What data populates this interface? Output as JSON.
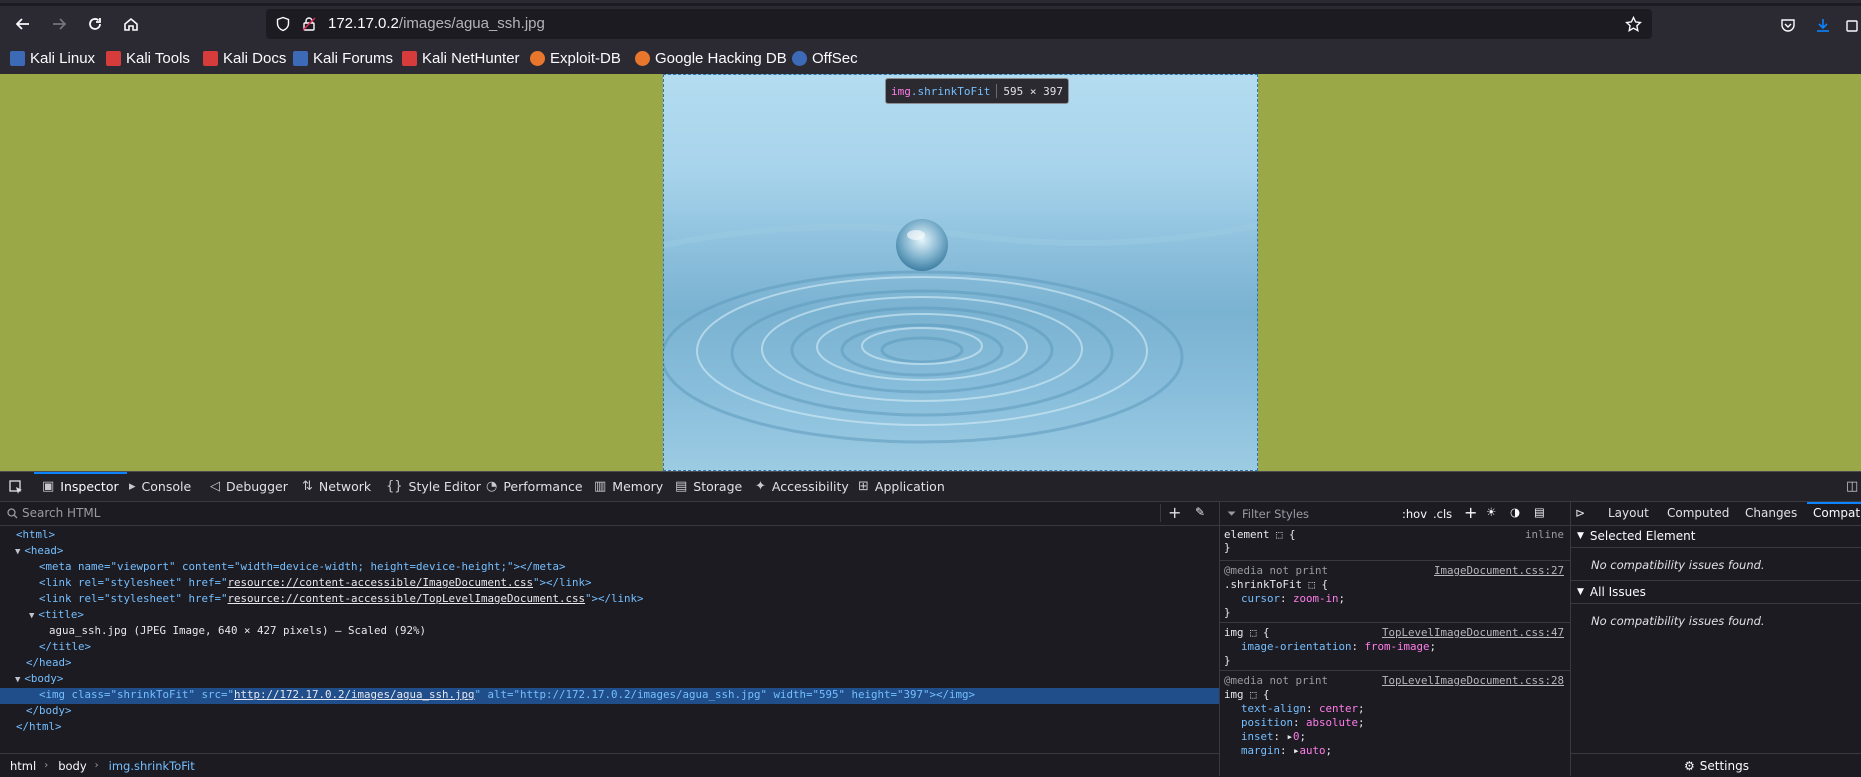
{
  "browser": {
    "url_host": "172.17.0.2",
    "url_path": "/images/agua_ssh.jpg"
  },
  "bookmarks": [
    {
      "label": "Kali Linux",
      "color": "#3d6ab7"
    },
    {
      "label": "Kali Tools",
      "color": "#d63c3c"
    },
    {
      "label": "Kali Docs",
      "color": "#d63c3c"
    },
    {
      "label": "Kali Forums",
      "color": "#3d6ab7"
    },
    {
      "label": "Kali NetHunter",
      "color": "#d63c3c"
    },
    {
      "label": "Exploit-DB",
      "color": "#e8762c"
    },
    {
      "label": "Google Hacking DB",
      "color": "#e8762c"
    },
    {
      "label": "OffSec",
      "color": "#3d6ab7"
    }
  ],
  "tooltip": {
    "tag": "img",
    "cls": ".shrinkToFit",
    "dims": "595 × 397"
  },
  "devtools": {
    "tabs": [
      "Inspector",
      "Console",
      "Debugger",
      "Network",
      "Style Editor",
      "Performance",
      "Memory",
      "Storage",
      "Accessibility",
      "Application"
    ],
    "search_placeholder": "Search HTML",
    "breadcrumb": [
      "html",
      "body",
      "img.shrinkToFit"
    ],
    "tree": {
      "html_open": "<html>",
      "head_open": "<head>",
      "meta": "<meta name=\"viewport\" content=\"width=device-width; height=device-height;\"></meta>",
      "link1_pre": "<link rel=\"stylesheet\" href=\"",
      "link1_href": "resource://content-accessible/ImageDocument.css",
      "link1_post": "\"></link>",
      "link2_href": "resource://content-accessible/TopLevelImageDocument.css",
      "title_open": "<title>",
      "title_text": "agua_ssh.jpg (JPEG Image, 640 × 427 pixels) — Scaled (92%)",
      "title_close": "</title>",
      "head_close": "</head>",
      "body_open": "<body>",
      "img_pre": "<img class=\"shrinkToFit\" src=\"",
      "img_src": "http://172.17.0.2/images/agua_ssh.jpg",
      "img_post": "\" alt=\"http://172.17.0.2/images/agua_ssh.jpg\" width=\"595\" height=\"397\"></img>",
      "body_close": "</body>",
      "html_close": "</html>"
    },
    "styles": {
      "filter_placeholder": "Filter Styles",
      "hov": ":hov",
      "cls": ".cls",
      "element_rule": "element",
      "inline": "inline",
      "media_print": "@media not print",
      "rule1_sel": ".shrinkToFit",
      "rule1_src": "ImageDocument.css:27",
      "rule1_prop": "cursor",
      "rule1_val": "zoom-in",
      "rule2_sel": "img",
      "rule2_src": "TopLevelImageDocument.css:47",
      "rule2_prop": "image-orientation",
      "rule2_val": "from-image",
      "rule3_src": "TopLevelImageDocument.css:28",
      "rule3_props": [
        {
          "p": "text-align",
          "v": "center"
        },
        {
          "p": "position",
          "v": "absolute"
        },
        {
          "p": "inset",
          "v": "0"
        },
        {
          "p": "margin",
          "v": "auto"
        }
      ]
    },
    "compat": {
      "tabs": [
        "Layout",
        "Computed",
        "Changes",
        "Compatibility"
      ],
      "selected_element": "Selected Element",
      "all_issues": "All Issues",
      "no_issues": "No compatibility issues found.",
      "settings": "Settings"
    }
  }
}
